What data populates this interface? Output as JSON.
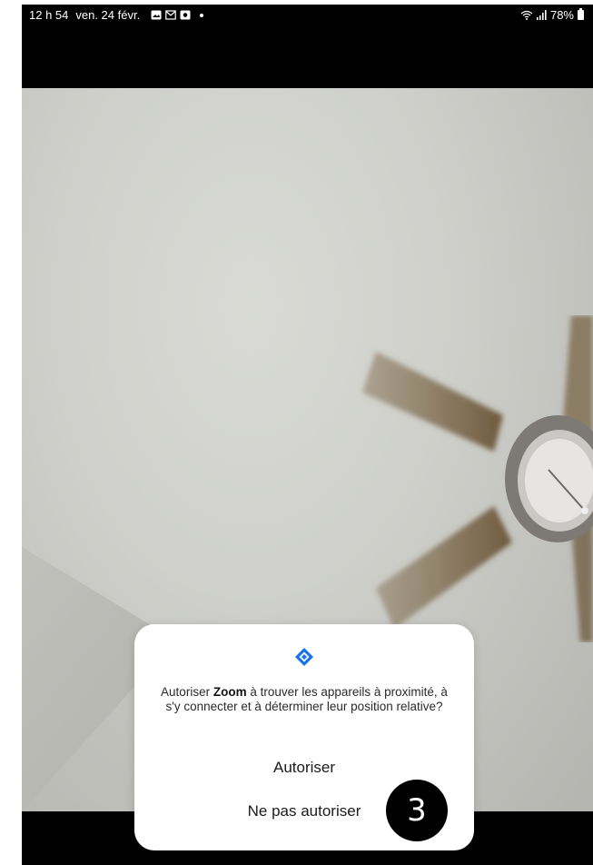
{
  "status_bar": {
    "time": "12 h 54",
    "date": "ven. 24 févr.",
    "battery": "78%",
    "notification_icons": [
      "gallery-icon",
      "mail-icon",
      "app-icon",
      "dot-icon"
    ],
    "system_icons": [
      "wifi-icon",
      "signal-icon",
      "battery-icon"
    ]
  },
  "dialog": {
    "icon": "nearby-devices-icon",
    "message_prefix": "Autoriser ",
    "app_name": "Zoom",
    "message_suffix": " à trouver les appareils à proximité, à s'y connecter et à déterminer leur position relative?",
    "allow_label": "Autoriser",
    "deny_label": "Ne pas autoriser"
  },
  "step_badge": "3",
  "colors": {
    "accent": "#1a73e8",
    "dialog_bg": "#ffffff",
    "text": "#1b1b1b"
  }
}
